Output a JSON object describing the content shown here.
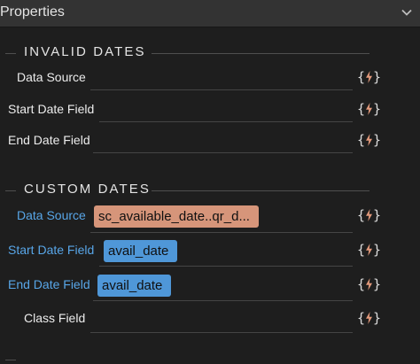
{
  "header": {
    "title": "Properties"
  },
  "invalid_dates": {
    "title": "INVALID DATES",
    "fields": [
      {
        "label": "Data Source",
        "value": ""
      },
      {
        "label": "Start Date Field",
        "value": ""
      },
      {
        "label": "End Date Field",
        "value": ""
      }
    ]
  },
  "custom_dates": {
    "title": "CUSTOM DATES",
    "fields": [
      {
        "label": "Data Source",
        "value": "sc_available_date..qr_d..."
      },
      {
        "label": "Start Date Field",
        "value": "avail_date"
      },
      {
        "label": "End Date Field",
        "value": "avail_date"
      },
      {
        "label": "Class Field",
        "value": ""
      }
    ]
  },
  "binding_icon": {
    "name": "lightning-binding-icon",
    "open_brace": "{",
    "close_brace": "}"
  },
  "colors": {
    "header_bg": "#333333",
    "panel_bg": "#1e1e1e",
    "bound_label": "#58a6e8",
    "custom_chip": "#d6957a",
    "field_chip": "#4f97d8",
    "bolt": "#e39a7c"
  }
}
